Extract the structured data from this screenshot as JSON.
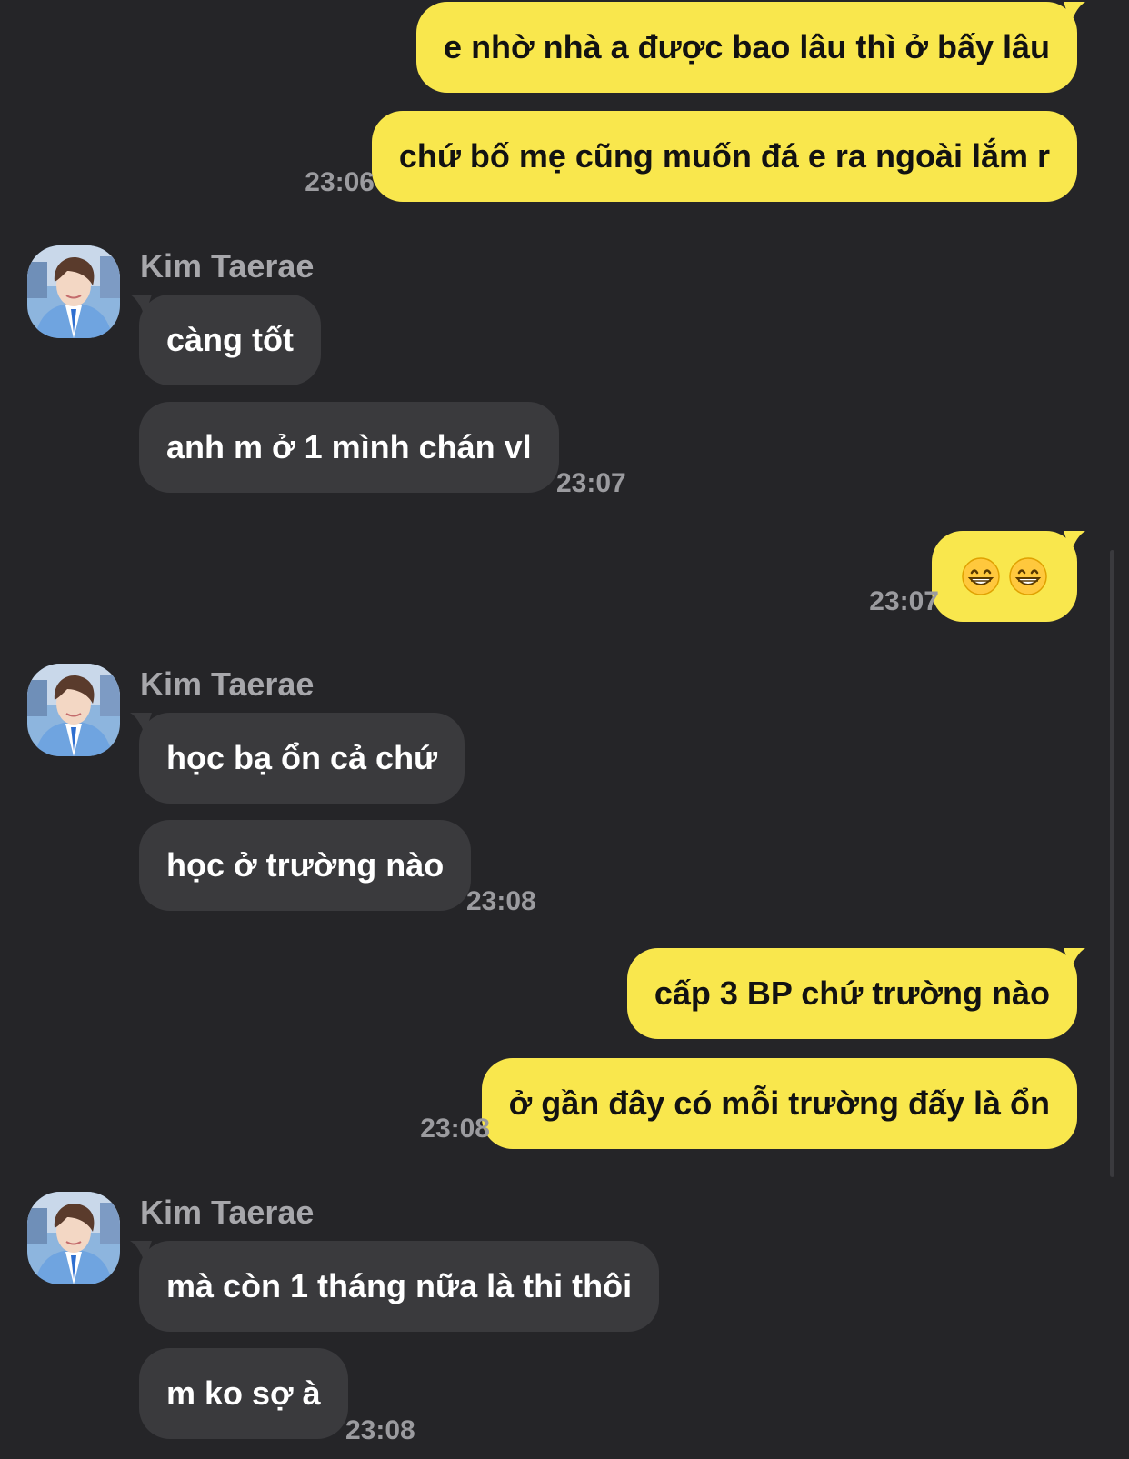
{
  "chat": {
    "contact_name": "Kim Taerae",
    "messages": [
      {
        "text": "e nhờ nhà a được bao lâu thì ở bấy lâu"
      },
      {
        "text": "chứ bố mẹ cũng muốn đá e ra ngoài lắm r",
        "time": "23:06"
      },
      {
        "text": "càng tốt"
      },
      {
        "text": "anh m ở 1 mình chán vl",
        "time": "23:07"
      },
      {
        "emoji": [
          "grinning-face-with-smiling-eyes",
          "grinning-face-with-smiling-eyes"
        ],
        "time": "23:07"
      },
      {
        "text": "học bạ ổn cả chứ"
      },
      {
        "text": "học ở trường nào",
        "time": "23:08"
      },
      {
        "text": "cấp 3 BP chứ trường nào"
      },
      {
        "text": "ở gần đây có mỗi trường đấy là ổn",
        "time": "23:08"
      },
      {
        "text": "mà còn 1 tháng nữa là thi thôi"
      },
      {
        "text": "m ko sợ à",
        "time": "23:08"
      }
    ]
  },
  "colors": {
    "background": "#252528",
    "outgoing_bubble": "#F9E74D",
    "incoming_bubble": "#3a3a3d",
    "timestamp": "#9b9b9f"
  }
}
